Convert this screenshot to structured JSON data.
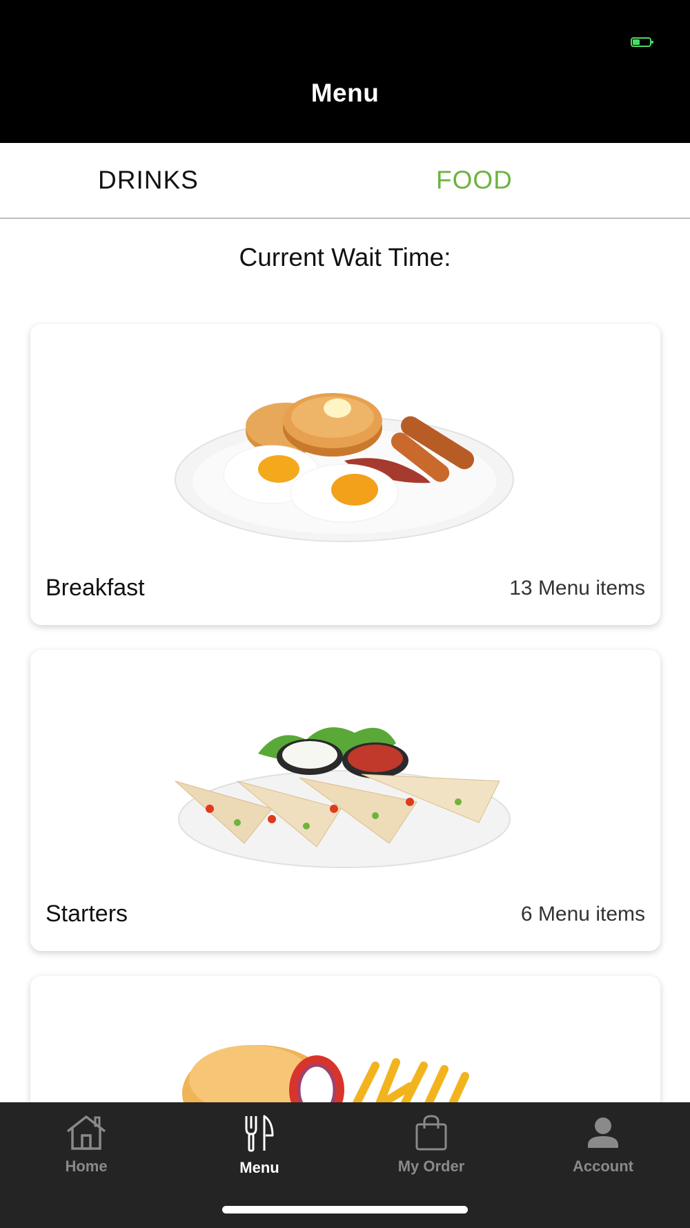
{
  "status_bar": {
    "battery_icon": "battery-charging-icon",
    "battery_color": "#4cd964"
  },
  "header": {
    "title": "Menu"
  },
  "tabs": {
    "drinks_label": "DRINKS",
    "food_label": "FOOD",
    "active": "FOOD",
    "active_color": "#6cb43f"
  },
  "wait_time": {
    "label": "Current Wait Time:"
  },
  "categories": [
    {
      "name": "Breakfast",
      "count_label": "13 Menu items",
      "image": "breakfast-plate-image"
    },
    {
      "name": "Starters",
      "count_label": "6 Menu items",
      "image": "quesadilla-plate-image"
    },
    {
      "name": "",
      "count_label": "",
      "image": "burger-fries-image"
    }
  ],
  "bottom_nav": {
    "items": [
      {
        "label": "Home",
        "icon": "home-icon"
      },
      {
        "label": "Menu",
        "icon": "fork-knife-icon"
      },
      {
        "label": "My Order",
        "icon": "shopping-bag-icon"
      },
      {
        "label": "Account",
        "icon": "person-icon"
      }
    ],
    "active": "Menu"
  }
}
